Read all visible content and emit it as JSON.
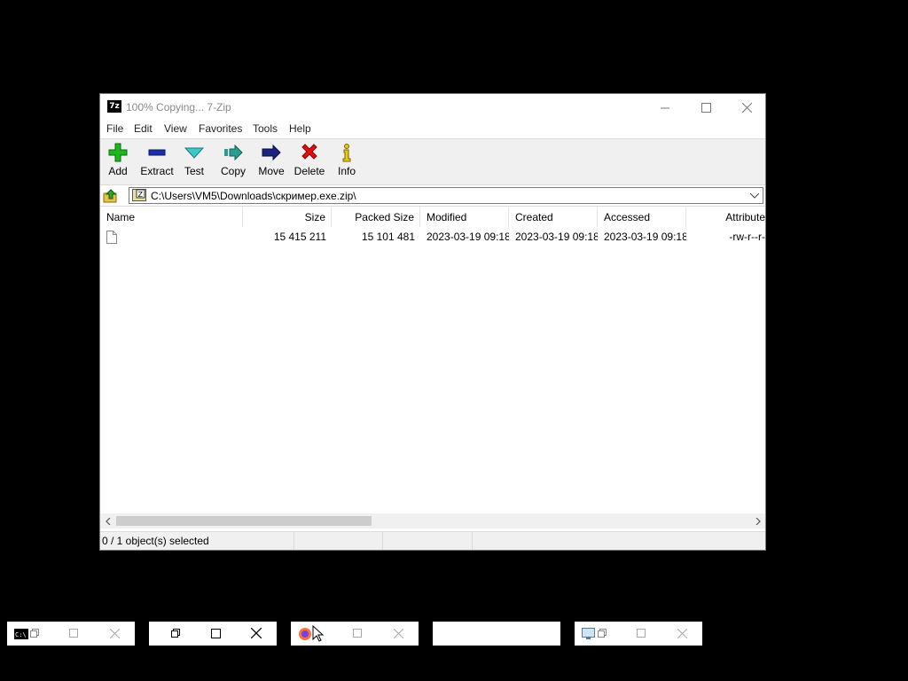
{
  "window": {
    "title": "100% Copying... 7-Zip",
    "app_icon_text": "7z"
  },
  "menu": [
    "File",
    "Edit",
    "View",
    "Favorites",
    "Tools",
    "Help"
  ],
  "toolbar": [
    {
      "label": "Add",
      "icon": "plus-icon"
    },
    {
      "label": "Extract",
      "icon": "minus-icon"
    },
    {
      "label": "Test",
      "icon": "check-arrow-icon"
    },
    {
      "label": "Copy",
      "icon": "copy-arrow-icon"
    },
    {
      "label": "Move",
      "icon": "move-arrow-icon"
    },
    {
      "label": "Delete",
      "icon": "delete-x-icon"
    },
    {
      "label": "Info",
      "icon": "info-icon"
    }
  ],
  "address": {
    "path": "C:\\Users\\VM5\\Downloads\\скример.exe.zip\\"
  },
  "columns": [
    "Name",
    "Size",
    "Packed Size",
    "Modified",
    "Created",
    "Accessed",
    "Attribute"
  ],
  "rows": [
    {
      "name": "",
      "size": "15 415 211",
      "packed_size": "15 101 481",
      "modified": "2023-03-19 09:18",
      "created": "2023-03-19 09:18",
      "accessed": "2023-03-19 09:18",
      "attributes": "-rw-r--r-"
    }
  ],
  "status": {
    "selection": "0 / 1 object(s) selected"
  },
  "colors": {
    "desktop": "#000000",
    "window_bg": "#ffffff",
    "toolbar_bg": "#f0f0f0",
    "add_green": "#1fb51f",
    "extract_blue": "#1c2fa8",
    "test_cyan": "#3cc8c8",
    "copy_teal": "#2a9d8f",
    "move_navy": "#1a237e",
    "delete_red": "#e01010"
  }
}
